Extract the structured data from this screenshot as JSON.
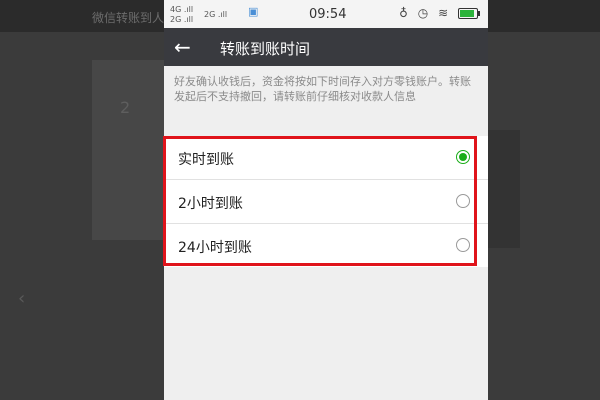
{
  "background": {
    "app_title": "微信转账到人",
    "heading_fragment": "2",
    "left_arrow": "‹"
  },
  "statusbar": {
    "signal_1": "4G .ıll",
    "signal_2": "2G .ıll",
    "signal_3": "2G .ıll",
    "time": "09:54",
    "battery_level": 0.85
  },
  "appbar": {
    "back_icon": "←",
    "title": "转账到账时间"
  },
  "notice": "好友确认收钱后，资金将按如下时间存入对方零钱账户。转账发起后不支持撤回，请转账前仔细核对收款人信息",
  "options": [
    {
      "label": "实时到账",
      "checked": true
    },
    {
      "label": "2小时到账",
      "checked": false
    },
    {
      "label": "24小时到账",
      "checked": false
    }
  ],
  "colors": {
    "accent_green": "#1aad19",
    "highlight_red": "#e0141b",
    "appbar": "#393a3f"
  }
}
